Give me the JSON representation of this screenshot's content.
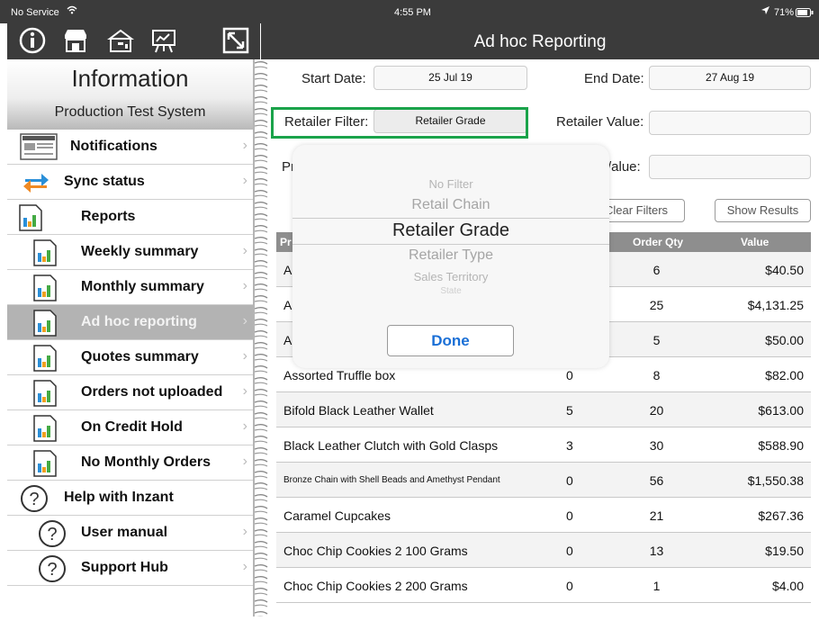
{
  "status_bar": {
    "carrier": "No Service",
    "time": "4:55 PM",
    "battery": "71%"
  },
  "toolbar": {
    "icons": [
      "info-icon",
      "store-icon",
      "cash-register-icon",
      "presentation-icon",
      "expand-icon"
    ],
    "title": "Ad hoc Reporting"
  },
  "sidebar": {
    "title": "Information",
    "subtitle": "Production Test System",
    "items": [
      {
        "label": "Notifications",
        "icon": "notifications-icon",
        "indent": false,
        "selected": false
      },
      {
        "label": "Sync status",
        "icon": "sync-icon",
        "indent": false,
        "selected": false
      },
      {
        "label": "Reports",
        "icon": "report-icon",
        "indent": true,
        "selected": false
      },
      {
        "label": "Weekly summary",
        "icon": "report-icon",
        "indent": true,
        "selected": false
      },
      {
        "label": "Monthly summary",
        "icon": "report-icon",
        "indent": true,
        "selected": false
      },
      {
        "label": "Ad hoc reporting",
        "icon": "report-icon",
        "indent": true,
        "selected": true
      },
      {
        "label": "Quotes summary",
        "icon": "report-icon",
        "indent": true,
        "selected": false
      },
      {
        "label": "Orders not uploaded",
        "icon": "report-icon",
        "indent": true,
        "selected": false
      },
      {
        "label": "On Credit Hold",
        "icon": "report-icon",
        "indent": true,
        "selected": false
      },
      {
        "label": "No Monthly Orders",
        "icon": "report-icon",
        "indent": true,
        "selected": false
      },
      {
        "label": "Help with Inzant",
        "icon": "help-icon",
        "indent": false,
        "selected": false
      },
      {
        "label": "User manual",
        "icon": "help-icon",
        "indent": true,
        "selected": false
      },
      {
        "label": "Support Hub",
        "icon": "help-icon",
        "indent": true,
        "selected": false
      }
    ]
  },
  "filters": {
    "start_date_label": "Start Date:",
    "start_date_value": "25 Jul 19",
    "end_date_label": "End Date:",
    "end_date_value": "27 Aug 19",
    "retailer_filter_label": "Retailer Filter:",
    "retailer_filter_value": "Retailer Grade",
    "retailer_value_label": "Retailer Value:",
    "retailer_value_value": "",
    "product_label_partial": "Pr",
    "value_label_partial": "/alue:",
    "clear_filters_label": "Clear Filters",
    "show_results_label": "Show Results"
  },
  "table": {
    "headers": {
      "product": "Pr",
      "order_qty": "Order Qty",
      "value": "Value"
    },
    "rows": [
      {
        "product": "A",
        "col2": "",
        "qty": "6",
        "value": "$40.50",
        "small": false
      },
      {
        "product": "A",
        "col2": "",
        "qty": "25",
        "value": "$4,131.25",
        "small": false
      },
      {
        "product": "A",
        "col2": "",
        "qty": "5",
        "value": "$50.00",
        "small": false
      },
      {
        "product": "Assorted Truffle box",
        "col2": "0",
        "qty": "8",
        "value": "$82.00",
        "small": false
      },
      {
        "product": "Bifold Black Leather Wallet",
        "col2": "5",
        "qty": "20",
        "value": "$613.00",
        "small": false
      },
      {
        "product": "Black Leather Clutch with Gold Clasps",
        "col2": "3",
        "qty": "30",
        "value": "$588.90",
        "small": false
      },
      {
        "product": "Bronze Chain with Shell Beads and Amethyst Pendant",
        "col2": "0",
        "qty": "56",
        "value": "$1,550.38",
        "small": true
      },
      {
        "product": "Caramel Cupcakes",
        "col2": "0",
        "qty": "21",
        "value": "$267.36",
        "small": false
      },
      {
        "product": "Choc Chip Cookies 2 100 Grams",
        "col2": "0",
        "qty": "13",
        "value": "$19.50",
        "small": false
      },
      {
        "product": "Choc Chip Cookies 2 200 Grams",
        "col2": "0",
        "qty": "1",
        "value": "$4.00",
        "small": false
      }
    ]
  },
  "picker": {
    "options": [
      "No Filter",
      "Retail Chain",
      "Retailer Grade",
      "Retailer Type",
      "Sales Territory",
      "State"
    ],
    "selected": "Retailer Grade",
    "done_label": "Done"
  },
  "colors": {
    "toolbar": "#3b3b3b",
    "highlight": "#1aa34a",
    "done_text": "#1a6fd6",
    "selected_row": "#b3b3b3"
  }
}
